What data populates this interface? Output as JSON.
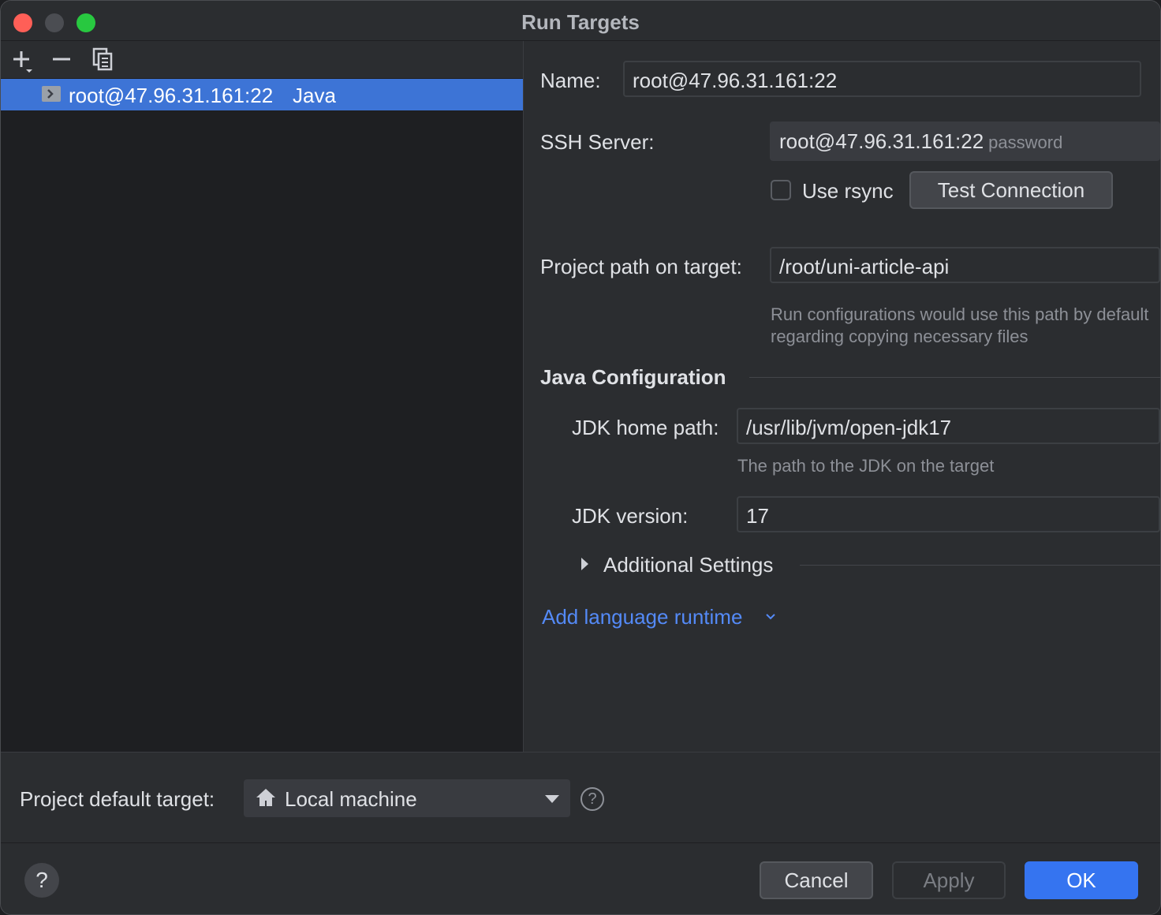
{
  "window": {
    "title": "Run Targets"
  },
  "toolbar": {
    "add_icon": "plus-icon",
    "remove_icon": "minus-icon",
    "copy_icon": "copy-icon"
  },
  "targets": [
    {
      "name": "root@47.96.31.161:22",
      "type": "Java",
      "icon": "ssh-target-icon",
      "selected": true
    }
  ],
  "form": {
    "name_label": "Name:",
    "name_value": "root@47.96.31.161:22",
    "ssh_label": "SSH Server:",
    "ssh_value": "root@47.96.31.161:22",
    "ssh_auth": "password",
    "rsync_label": "Use rsync",
    "rsync_checked": false,
    "test_connection_label": "Test Connection",
    "project_path_label": "Project path on target:",
    "project_path_value": "/root/uni-article-api",
    "project_path_hint_line1": "Run configurations would use this path by default",
    "project_path_hint_line2": "regarding copying necessary files",
    "java_section_title": "Java Configuration",
    "jdk_home_label": "JDK home path:",
    "jdk_home_value": "/usr/lib/jvm/open-jdk17",
    "jdk_home_hint": "The path to the JDK on the target",
    "jdk_version_label": "JDK version:",
    "jdk_version_value": "17",
    "additional_settings_label": "Additional Settings",
    "add_runtime_label": "Add language runtime"
  },
  "bottom": {
    "default_target_label": "Project default target:",
    "default_target_value": "Local machine",
    "help_glyph": "?",
    "cancel_label": "Cancel",
    "apply_label": "Apply",
    "ok_label": "OK"
  },
  "colors": {
    "accent": "#3574f0",
    "selection": "#3d74d6",
    "link": "#548af7"
  }
}
